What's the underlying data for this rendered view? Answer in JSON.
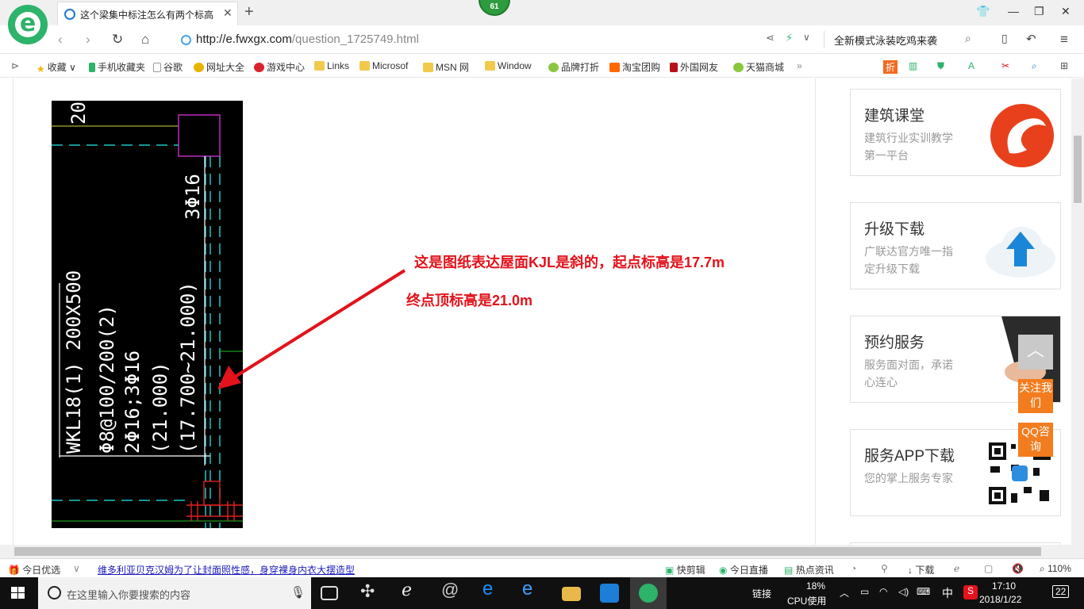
{
  "browser": {
    "logo_letter": "e",
    "tab_title": "这个梁集中标注怎么有两个标高",
    "tab_close": "✕",
    "new_tab": "+",
    "badge_count": "61",
    "url_host": "http://e.fwxgx.com",
    "url_path": "/question_1725749.html",
    "search_text": "全新模式泳装吃鸡来袭"
  },
  "bookmarks": [
    "收藏",
    "手机收藏夹",
    "谷歌",
    "网址大全",
    "游戏中心",
    "Links",
    "Microsof",
    "MSN 网",
    "Window",
    "品牌打折",
    "淘宝团购",
    "外国网友",
    "天猫商城"
  ],
  "drawing": {
    "text_top": "20",
    "text_3phi16": "3Φ16",
    "beam_label": "WKL18(1) 200X500",
    "stirrup": "Φ8@100/200(2)",
    "bars": "2Φ16;3Φ16",
    "elev1": "(21.000)",
    "elev2": "(17.700~21.000)"
  },
  "annotation": {
    "line1": "这是图纸表达屋面KJL是斜的，起点标高是17.7m",
    "line2": "终点顶标高是21.0m"
  },
  "sidebar": [
    {
      "title": "建筑课堂",
      "desc": "建筑行业实训教学第一平台"
    },
    {
      "title": "升级下载",
      "desc": "广联达官方唯一指定升级下载"
    },
    {
      "title": "预约服务",
      "desc": "服务面对面，承诺心连心"
    },
    {
      "title": "服务APP下载",
      "desc": "您的掌上服务专家"
    }
  ],
  "floating": {
    "follow": "关注我们",
    "qq": "QQ咨询"
  },
  "statusbar": {
    "today": "今日优选",
    "headline": "维多利亚贝克汉姆为了让封面照性感，身穿裸身内衣大摆造型",
    "kuaijian": "快剪辑",
    "live": "今日直播",
    "news": "热点资讯",
    "download": "下载",
    "zoom": "110%"
  },
  "taskbar": {
    "search_placeholder": "在这里输入你要搜索的内容",
    "link": "链接",
    "cpu_pct": "18%",
    "cpu_label": "CPU使用",
    "ime": "中",
    "time": "17:10",
    "date": "2018/1/22",
    "notif": "22"
  }
}
